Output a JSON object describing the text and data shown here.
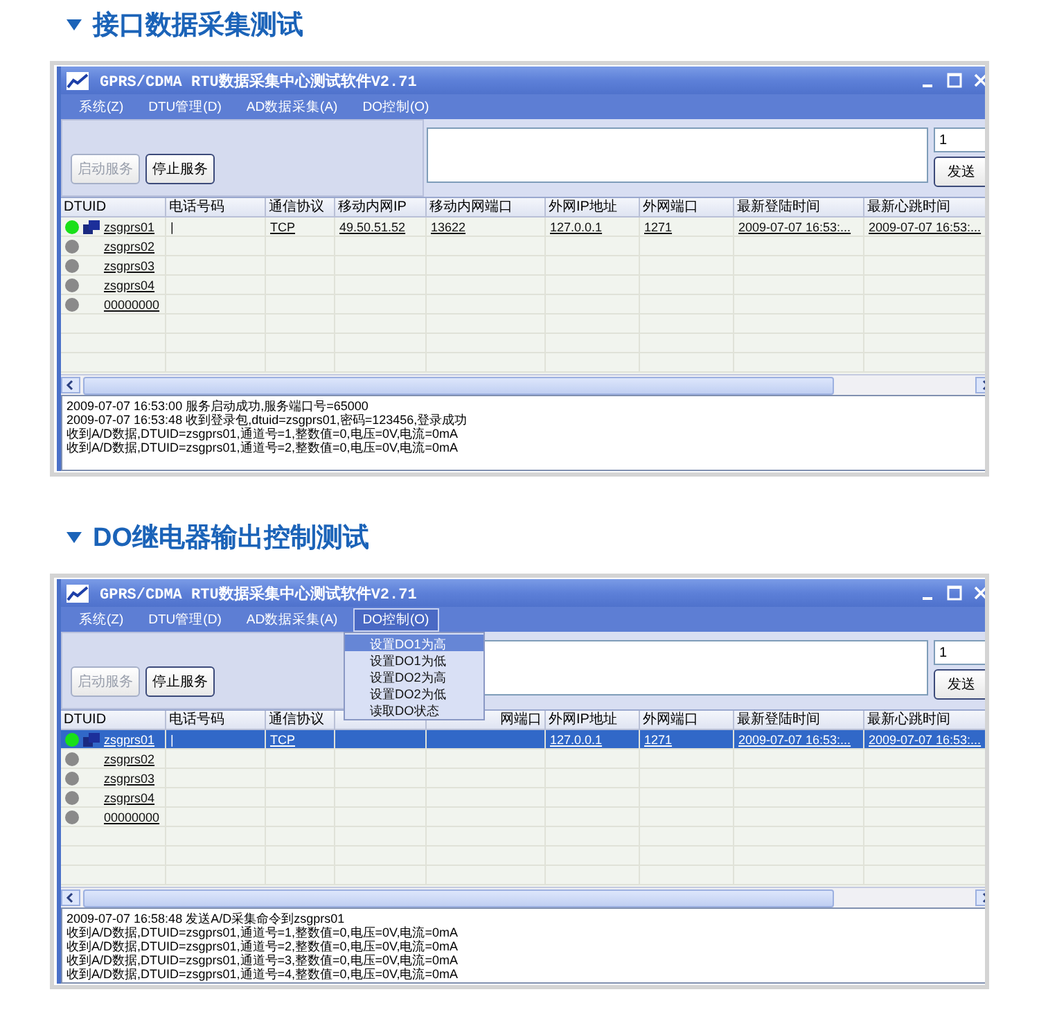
{
  "sections": [
    {
      "heading": "接口数据采集测试",
      "window": {
        "title": "GPRS/CDMA RTU数据采集中心测试软件V2.71",
        "menu": [
          {
            "label": "系统(Z)",
            "selected": false
          },
          {
            "label": "DTU管理(D)",
            "selected": false
          },
          {
            "label": "AD数据采集(A)",
            "selected": false
          },
          {
            "label": "DO控制(O)",
            "selected": false
          }
        ],
        "buttons": [
          {
            "label": "启动服务",
            "disabled": true
          },
          {
            "label": "停止服务",
            "disabled": false
          }
        ],
        "count_field": {
          "value": "1"
        },
        "send_button": "发送",
        "columns": [
          {
            "label": "DTUID"
          },
          {
            "label": "电话号码"
          },
          {
            "label": "通信协议"
          },
          {
            "label": "移动内网IP"
          },
          {
            "label": "移动内网端口"
          },
          {
            "label": "外网IP地址"
          },
          {
            "label": "外网端口"
          },
          {
            "label": "最新登陆时间"
          },
          {
            "label": "最新心跳时间"
          }
        ],
        "rows": [
          {
            "online": true,
            "selected": false,
            "cells": [
              "zsgprs01",
              "|",
              "TCP",
              "49.50.51.52",
              "13622",
              "127.0.0.1",
              "1271",
              "2009-07-07 16:53:...",
              "2009-07-07 16:53:..."
            ]
          },
          {
            "online": false,
            "selected": false,
            "cells": [
              "zsgprs02"
            ]
          },
          {
            "online": false,
            "selected": false,
            "cells": [
              "zsgprs03"
            ]
          },
          {
            "online": false,
            "selected": false,
            "cells": [
              "zsgprs04"
            ]
          },
          {
            "online": false,
            "selected": false,
            "cells": [
              "00000000"
            ]
          }
        ],
        "log": [
          "2009-07-07 16:53:00 服务启动成功,服务端口号=65000",
          "2009-07-07 16:53:48 收到登录包,dtuid=zsgprs01,密码=123456,登录成功",
          "收到A/D数据,DTUID=zsgprs01,通道号=1,整数值=0,电压=0V,电流=0mA",
          "收到A/D数据,DTUID=zsgprs01,通道号=2,整数值=0,电压=0V,电流=0mA"
        ]
      }
    },
    {
      "heading": "DO继电器输出控制测试",
      "window": {
        "title": "GPRS/CDMA RTU数据采集中心测试软件V2.71",
        "menu": [
          {
            "label": "系统(Z)",
            "selected": false
          },
          {
            "label": "DTU管理(D)",
            "selected": false
          },
          {
            "label": "AD数据采集(A)",
            "selected": false
          },
          {
            "label": "DO控制(O)",
            "selected": true
          }
        ],
        "dropdown": [
          {
            "label": "设置DO1为高",
            "selected": true
          },
          {
            "label": "设置DO1为低",
            "selected": false
          },
          {
            "label": "设置DO2为高",
            "selected": false
          },
          {
            "label": "设置DO2为低",
            "selected": false
          },
          {
            "label": "读取DO状态",
            "selected": false
          }
        ],
        "buttons": [
          {
            "label": "启动服务",
            "disabled": true
          },
          {
            "label": "停止服务",
            "disabled": false
          }
        ],
        "count_field": {
          "value": "1"
        },
        "send_button": "发送",
        "columns": [
          {
            "label": "DTUID"
          },
          {
            "label": "电话号码"
          },
          {
            "label": "通信协议"
          },
          {},
          {
            "label": "网端口",
            "cut_left": true
          },
          {
            "label": "外网IP地址"
          },
          {
            "label": "外网端口"
          },
          {
            "label": "最新登陆时间"
          },
          {
            "label": "最新心跳时间"
          }
        ],
        "rows": [
          {
            "online": true,
            "selected": true,
            "cells": [
              "zsgprs01",
              "|",
              "TCP",
              null,
              null,
              "127.0.0.1",
              "1271",
              "2009-07-07 16:53:...",
              "2009-07-07 16:53:..."
            ]
          },
          {
            "online": false,
            "selected": false,
            "cells": [
              "zsgprs02"
            ]
          },
          {
            "online": false,
            "selected": false,
            "cells": [
              "zsgprs03"
            ]
          },
          {
            "online": false,
            "selected": false,
            "cells": [
              "zsgprs04"
            ]
          },
          {
            "online": false,
            "selected": false,
            "cells": [
              "00000000"
            ]
          }
        ],
        "log": [
          "2009-07-07 16:58:48 发送A/D采集命令到zsgprs01",
          "收到A/D数据,DTUID=zsgprs01,通道号=1,整数值=0,电压=0V,电流=0mA",
          "收到A/D数据,DTUID=zsgprs01,通道号=2,整数值=0,电压=0V,电流=0mA",
          "收到A/D数据,DTUID=zsgprs01,通道号=3,整数值=0,电压=0V,电流=0mA",
          "收到A/D数据,DTUID=zsgprs01,通道号=4,整数值=0,电压=0V,电流=0mA"
        ]
      }
    }
  ]
}
